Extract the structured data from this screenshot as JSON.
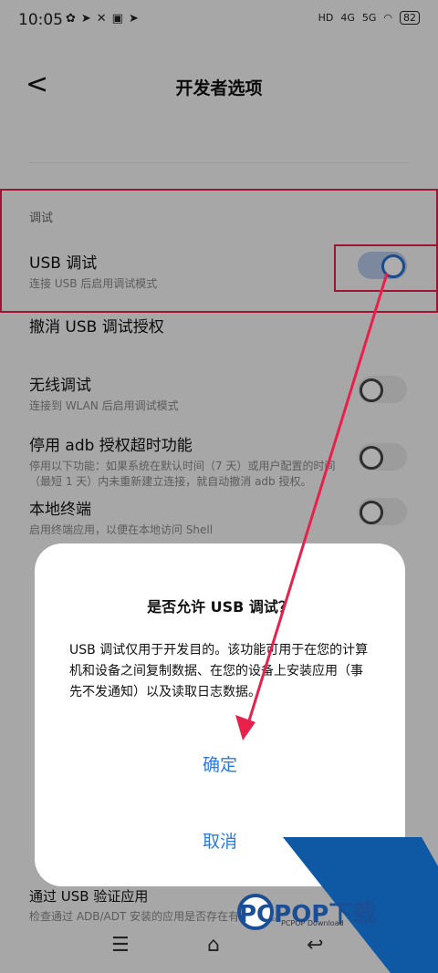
{
  "status": {
    "time": "10:05",
    "battery": "82",
    "net1": "4G",
    "net2": "5G",
    "hd": "HD"
  },
  "header": {
    "back": "<",
    "title": "开发者选项"
  },
  "section_label": "调试",
  "settings": [
    {
      "title": "USB 调试",
      "subtitle": "连接 USB 后启用调试模式",
      "on": true
    },
    {
      "title": "撤消 USB 调试授权",
      "subtitle": ""
    },
    {
      "title": "无线调试",
      "subtitle": "连接到 WLAN 后启用调试模式",
      "on": false
    },
    {
      "title": "停用 adb 授权超时功能",
      "subtitle": "停用以下功能：如果系统在默认时间（7 天）或用户配置的时间（最短 1 天）内未重新建立连接，就自动撤消 adb 授权。",
      "on": false
    },
    {
      "title": "本地终端",
      "subtitle": "启用终端应用，以便在本地访问 Shell",
      "on": false
    },
    {
      "title": "通过 USB 验证应用",
      "subtitle": "检查通过 ADB/ADT 安装的应用是否存在有害行为。"
    }
  ],
  "dialog": {
    "title": "是否允许 USB 调试？",
    "body": "USB 调试仅用于开发目的。该功能可用于在您的计算机和设备之间复制数据、在您的设备上安装应用（事先不发通知）以及读取日志数据。",
    "confirm": "确定",
    "cancel": "取消"
  },
  "watermark": {
    "text": "PCPOP下载",
    "sub": "PCPOP Download"
  },
  "colors": {
    "accent": "#2a7be0",
    "annotation": "#e8204c",
    "watermark": "#1b4f95"
  }
}
